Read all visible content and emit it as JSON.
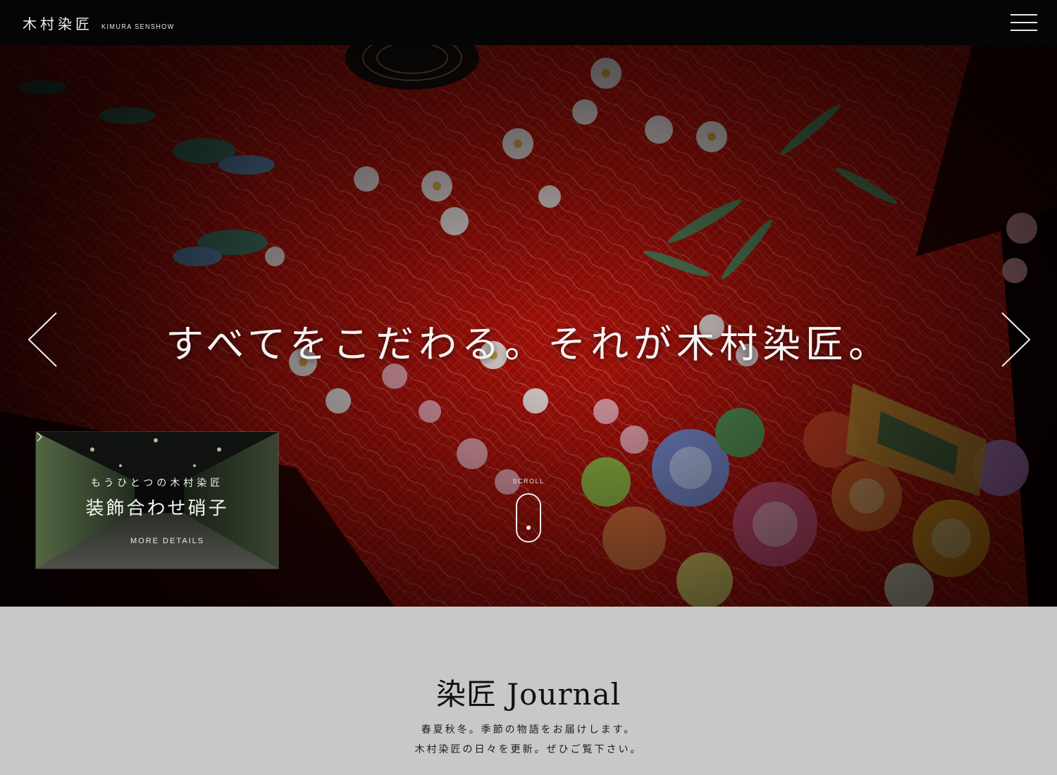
{
  "header": {
    "logo_jp": "木村染匠",
    "logo_en": "KIMURA SENSHOW",
    "menu_icon": "hamburger-icon"
  },
  "hero": {
    "tagline": "すべてをこだわる。それが木村染匠。",
    "prev_icon": "chevron-left-icon",
    "next_icon": "chevron-right-icon",
    "scroll_label": "SCROLL"
  },
  "promo": {
    "subtitle": "もうひとつの木村染匠",
    "title": "装飾合わせ硝子",
    "link_label": "MORE DETAILS"
  },
  "journal": {
    "title": "染匠 Journal",
    "line1": "春夏秋冬。季節の物語をお届けします。",
    "line2": "木村染匠の日々を更新。ぜひご覧下さい。"
  },
  "colors": {
    "header_bg": "#050505",
    "kimono_red": "#b5120b",
    "section_bg": "#c8c8c8"
  }
}
